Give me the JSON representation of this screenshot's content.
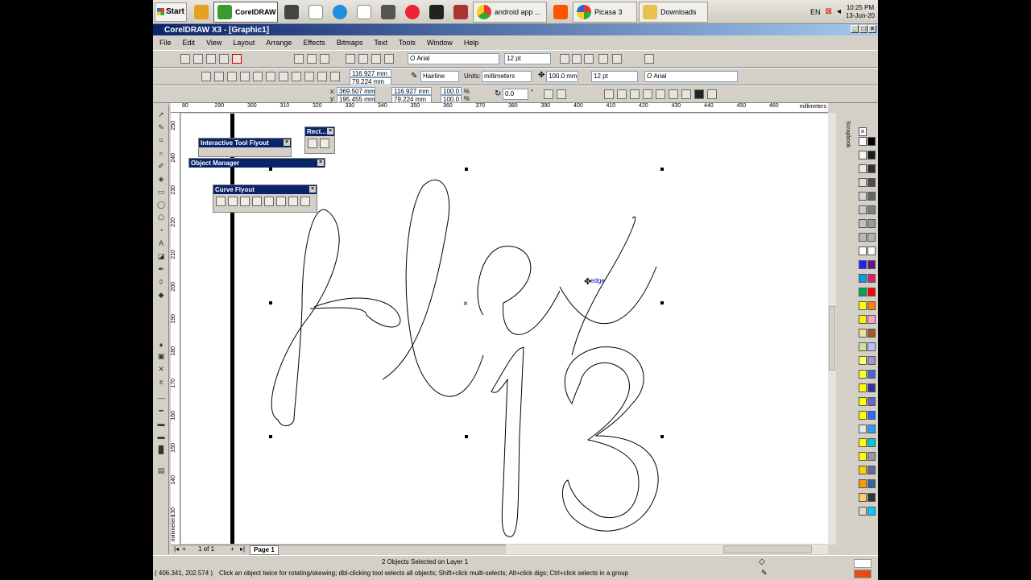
{
  "taskbar": {
    "start_label": "Start",
    "tasks": [
      "CorelDRAW ...",
      "android app ...",
      "Picasa 3",
      "Downloads"
    ],
    "lang": "EN",
    "time": "10:25 PM",
    "date": "13-Jun-20"
  },
  "window": {
    "title": "CorelDRAW X3 - [Graphic1]"
  },
  "menu": [
    "File",
    "Edit",
    "View",
    "Layout",
    "Arrange",
    "Effects",
    "Bitmaps",
    "Text",
    "Tools",
    "Window",
    "Help"
  ],
  "toolbar1": {
    "font_name": "Arial",
    "font_size": "12 pt"
  },
  "toolbar2": {
    "width": "116.927 mm",
    "height": "79.224 mm",
    "outline": "Hairline",
    "units_label": "Units:",
    "units": "millimeters",
    "nudge": "100.0 mm",
    "font_size": "12 pt",
    "font_name": "Arial"
  },
  "toolbar3": {
    "x_label": "x:",
    "x": "369.507 mm",
    "y_label": "y:",
    "y": "195.455 mm",
    "w": "116.927 mm",
    "h": "79.224 mm",
    "scale_x": "100.0",
    "scale_y": "100.0",
    "pct": "%",
    "angle": "0.0",
    "deg": "°"
  },
  "ruler": {
    "top_ticks": [
      "80",
      "290",
      "300",
      "310",
      "320",
      "330",
      "340",
      "350",
      "360",
      "370",
      "380",
      "390",
      "400",
      "410",
      "420",
      "430",
      "440",
      "450",
      "460"
    ],
    "top_unit": "millimeters",
    "left_ticks": [
      "250",
      "240",
      "230",
      "220",
      "210",
      "200",
      "190",
      "180",
      "170",
      "160",
      "150",
      "140",
      "130"
    ],
    "left_unit": "millimeters"
  },
  "flyouts": {
    "interactive": "Interactive Tool Flyout",
    "rect": "Rect...",
    "object_manager": "Object Manager",
    "curve": "Curve Flyout"
  },
  "canvas": {
    "snap_label": "edge",
    "text_main": "Alex",
    "text_num": "13"
  },
  "pagebar": {
    "page_count": "1 of 1",
    "page_tab": "Page 1"
  },
  "status": {
    "selection": "2 Objects Selected on Layer 1",
    "coords": "( 406.341, 202.574 )",
    "hint": "Click an object twice for rotating/skewing; dbl-clicking tool selects all objects; Shift+click multi-selects; Alt+click digs; Ctrl+click selects in a group"
  },
  "docker": {
    "scrapbook": "Scrapbook"
  },
  "palette_colors": [
    "#ffffff",
    "#000000",
    "#f5f5f5",
    "#1a1a1a",
    "#ebebeb",
    "#333333",
    "#e0e0e0",
    "#4d4d4d",
    "#d6d6d6",
    "#666666",
    "#cccccc",
    "#808080",
    "#c2c2c2",
    "#999999",
    "#b8b8b8",
    "#b3b3b3",
    "#ffffff",
    "#ffffff",
    "#1f1fff",
    "#5a1a8a",
    "#00a0e6",
    "#e0206c",
    "#00a651",
    "#ff0000",
    "#ffff00",
    "#ff7f00",
    "#fff200",
    "#ffa0c8",
    "#e9e6a0",
    "#a05a2c",
    "#c8e6a0",
    "#c0c0ff",
    "#ffff66",
    "#9999cc",
    "#ffff33",
    "#4d66cc",
    "#ffff00",
    "#333399",
    "#ffff00",
    "#6666cc",
    "#ffff00",
    "#3366ff",
    "#e6e6e6",
    "#3399ff",
    "#ffff00",
    "#00cccc",
    "#ffff00",
    "#999999",
    "#ffcc00",
    "#666699",
    "#ff9900",
    "#336699",
    "#ffcc66",
    "#333333",
    "#d9d9d9",
    "#00ccff"
  ]
}
